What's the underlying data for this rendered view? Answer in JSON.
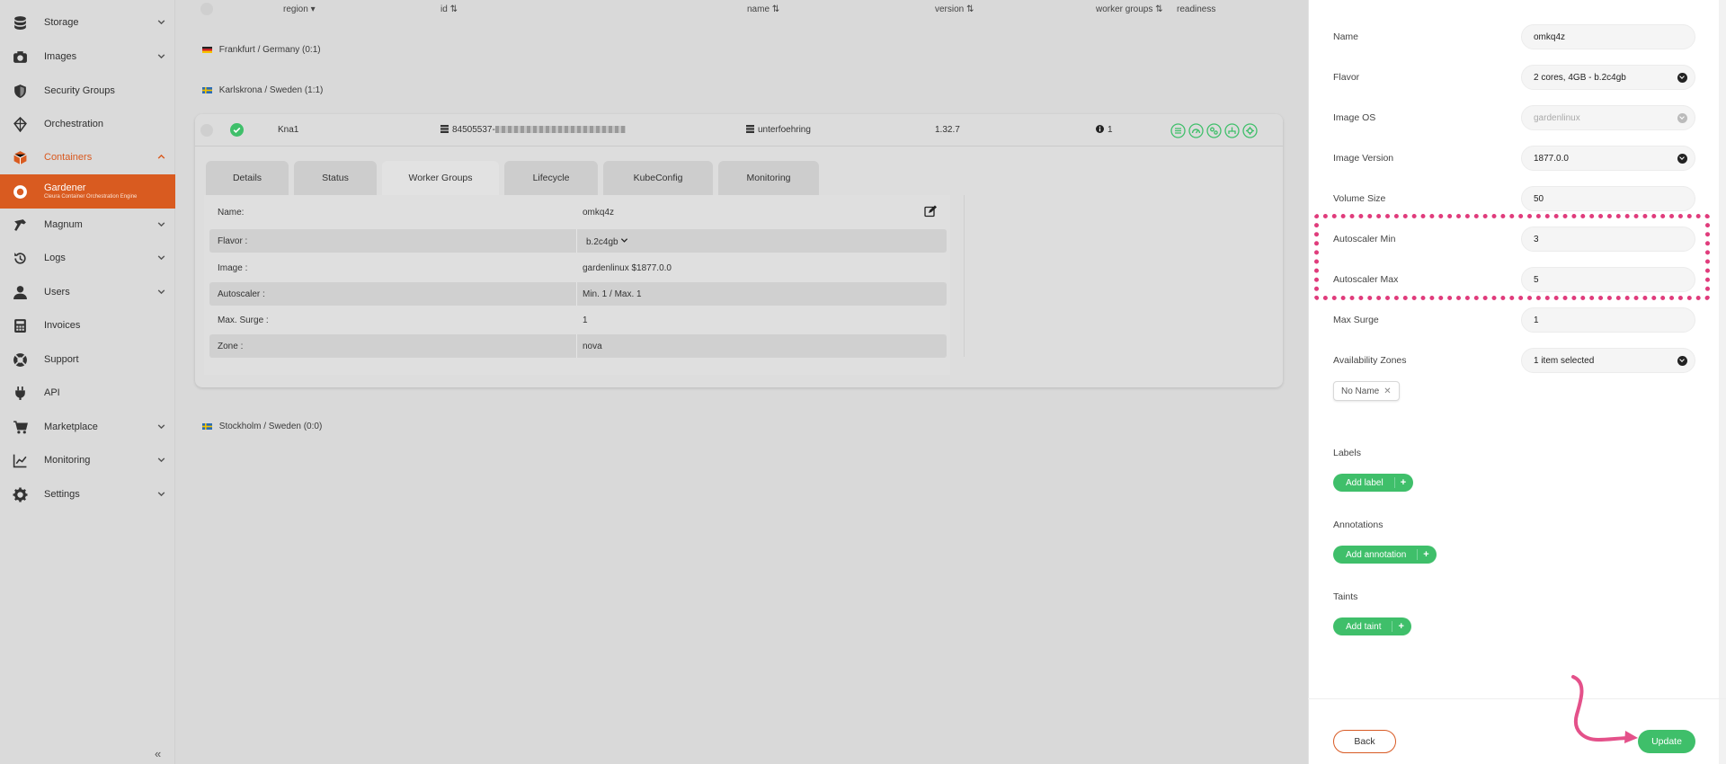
{
  "sidebar": {
    "items": [
      {
        "label": "Storage",
        "icon": "storage-icon",
        "chevron": true
      },
      {
        "label": "Images",
        "icon": "camera-icon",
        "chevron": true
      },
      {
        "label": "Security Groups",
        "icon": "shield-icon",
        "chevron": false
      },
      {
        "label": "Orchestration",
        "icon": "orchestration-icon",
        "chevron": false
      },
      {
        "label": "Containers",
        "icon": "box-icon",
        "chevron": true,
        "state": "expanded"
      },
      {
        "label": "Gardener",
        "sublabel": "Cleura Container Orchestration Engine",
        "icon": "gardener-icon",
        "state": "active"
      },
      {
        "label": "Magnum",
        "icon": "magnum-icon",
        "chevron": true
      },
      {
        "label": "Logs",
        "icon": "history-icon",
        "chevron": true
      },
      {
        "label": "Users",
        "icon": "user-icon",
        "chevron": true
      },
      {
        "label": "Invoices",
        "icon": "calculator-icon",
        "chevron": false
      },
      {
        "label": "Support",
        "icon": "lifebuoy-icon",
        "chevron": false
      },
      {
        "label": "API",
        "icon": "plug-icon",
        "chevron": false
      },
      {
        "label": "Marketplace",
        "icon": "cart-icon",
        "chevron": true
      },
      {
        "label": "Monitoring",
        "icon": "chart-line-icon",
        "chevron": true
      },
      {
        "label": "Settings",
        "icon": "gear-icon",
        "chevron": true
      }
    ],
    "collapse_label": "«"
  },
  "table": {
    "headers": {
      "region": "region",
      "id": "id",
      "name": "name",
      "version": "version",
      "worker_groups": "worker groups",
      "readiness": "readiness"
    },
    "regions": [
      {
        "label": "Frankfurt / Germany  (0:1)"
      },
      {
        "label": "Karlskrona / Sweden  (1:1)"
      },
      {
        "label": "Stockholm / Sweden  (0:0)"
      }
    ],
    "cluster": {
      "region": "Kna1",
      "id": "84505537-",
      "name": "unterfoehring",
      "version": "1.32.7",
      "worker_groups": "1"
    }
  },
  "tabs": [
    {
      "label": "Details"
    },
    {
      "label": "Status"
    },
    {
      "label": "Worker Groups",
      "selected": true
    },
    {
      "label": "Lifecycle"
    },
    {
      "label": "KubeConfig"
    },
    {
      "label": "Monitoring"
    }
  ],
  "worker_group": {
    "rows": [
      {
        "key": "Name:",
        "value": "omkq4z"
      },
      {
        "key": "Flavor :",
        "value": "b.2c4gb"
      },
      {
        "key": "Image :",
        "value": "gardenlinux $1877.0.0"
      },
      {
        "key": "Autoscaler :",
        "value": "Min. 1 / Max. 1"
      },
      {
        "key": "Max. Surge :",
        "value": "1"
      },
      {
        "key": "Zone :",
        "value": "nova"
      }
    ]
  },
  "form": {
    "fields": [
      {
        "label": "Name",
        "value": "omkq4z"
      },
      {
        "label": "Flavor",
        "value": "2 cores, 4GB - b.2c4gb",
        "dropdown": true
      },
      {
        "label": "Image OS",
        "value": "gardenlinux",
        "dropdown": true,
        "disabled": true
      },
      {
        "label": "Image Version",
        "value": "1877.0.0",
        "dropdown": true
      },
      {
        "label": "Volume Size",
        "value": "50"
      },
      {
        "label": "Autoscaler Min",
        "value": "3"
      },
      {
        "label": "Autoscaler Max",
        "value": "5"
      },
      {
        "label": "Max Surge",
        "value": "1"
      },
      {
        "label": "Availability Zones",
        "value": "1 item selected",
        "dropdown": true
      }
    ],
    "zone_chip": "No Name",
    "labels_title": "Labels",
    "add_label": "Add label",
    "annotations_title": "Annotations",
    "add_annotation": "Add annotation",
    "taints_title": "Taints",
    "add_taint": "Add taint",
    "plus": "+",
    "back": "Back",
    "update": "Update"
  },
  "colors": {
    "accent": "#d95b20",
    "green": "#3fbf6a",
    "highlight": "#e03c7c"
  }
}
